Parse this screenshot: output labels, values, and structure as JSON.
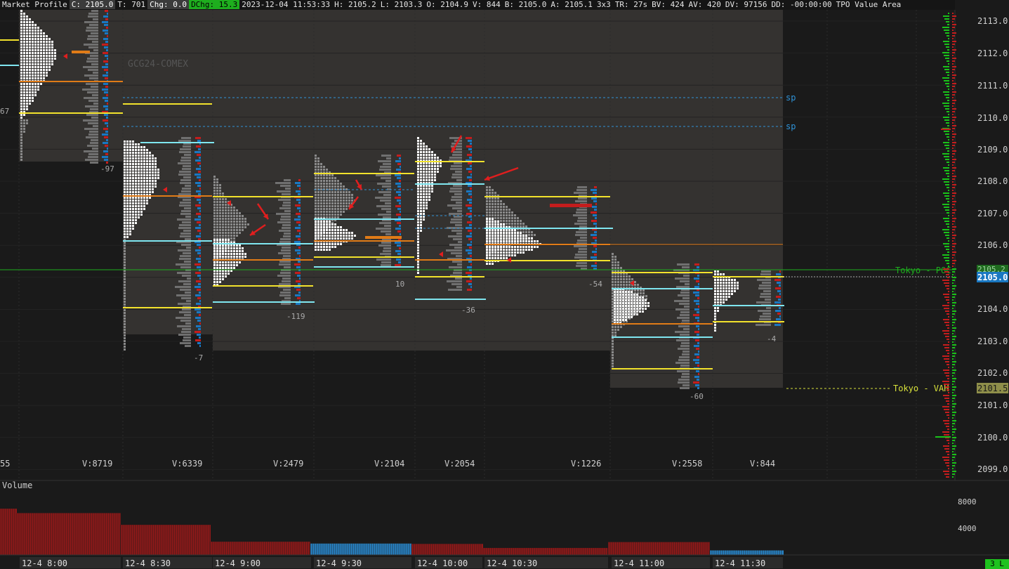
{
  "topbar": {
    "title": "Market Profile",
    "close": "C: 2105.0",
    "ticks": "T: 701",
    "chg": "Chg: 0.0",
    "dchg": "DChg: 15.3",
    "datetime": "2023-12-04 11:53:33",
    "high": "H: 2105.2",
    "low": "L: 2103.3",
    "open": "O: 2104.9",
    "volume": "V: 844",
    "bid": "B: 2105.0",
    "ask": "A: 2105.1",
    "size": "3x3",
    "tr": "TR: 27s",
    "bv": "BV: 424",
    "av": "AV: 420",
    "dv": "DV: 97156",
    "dd": "DD: -00:00:00",
    "mode": "TPO Value Area"
  },
  "instrument": "GCG24-COMEX",
  "price_axis": {
    "labels": [
      "2113.0",
      "2112.0",
      "2111.0",
      "2110.0",
      "2109.0",
      "2108.0",
      "2107.0",
      "2106.0",
      "2105.0",
      "2104.0",
      "2103.0",
      "2102.0",
      "2101.0",
      "2100.0",
      "2099.0"
    ],
    "current_price": "2105.0",
    "overlap_label": "2105.2",
    "vah_tag": "2101.5"
  },
  "reference_lines": {
    "sp1": "sp",
    "sp2": "sp",
    "tokyo_poc": "Tokyo - POC",
    "tokyo_vah": "Tokyo - VAH"
  },
  "sessions": [
    {
      "delta": "67",
      "volume": "V:8719"
    },
    {
      "delta": "-97",
      "volume": "V:6339"
    },
    {
      "delta": "-7",
      "volume": "V:2479"
    },
    {
      "delta": "-119",
      "volume": "V:2104"
    },
    {
      "delta": "10",
      "volume": "V:2054"
    },
    {
      "delta": "-36",
      "volume": "V:1226"
    },
    {
      "delta": "-54",
      "volume": "V:2558"
    },
    {
      "delta": "-60",
      "volume": "V:844"
    },
    {
      "delta": "-4",
      "volume": ""
    }
  ],
  "left_edge_volume": "55",
  "volume_pane": {
    "title": "Volume",
    "axis": [
      "8000",
      "4000"
    ],
    "bars": [
      {
        "value": 6300,
        "color": "red"
      },
      {
        "value": 5700,
        "color": "red"
      },
      {
        "value": 4100,
        "color": "red"
      },
      {
        "value": 1800,
        "color": "red"
      },
      {
        "value": 1550,
        "color": "blue"
      },
      {
        "value": 1500,
        "color": "red"
      },
      {
        "value": 950,
        "color": "red"
      },
      {
        "value": 1750,
        "color": "red"
      },
      {
        "value": 620,
        "color": "blue"
      }
    ]
  },
  "time_axis": [
    "12-4   8:00",
    "12-4   8:30",
    "12-4   9:00",
    "12-4   9:30",
    "12-4   10:00",
    "12-4   10:30",
    "12-4   11:00",
    "12-4   11:30"
  ],
  "status_corner": "3 L",
  "colors": {
    "poc": "#e07b17",
    "value_area": "#f2e22c",
    "hl": "#7fe6f0",
    "bid": "#c41d1d",
    "ask": "#1a78c2",
    "ladder_up": "#19c219",
    "ladder_dn": "#c41d1d"
  }
}
